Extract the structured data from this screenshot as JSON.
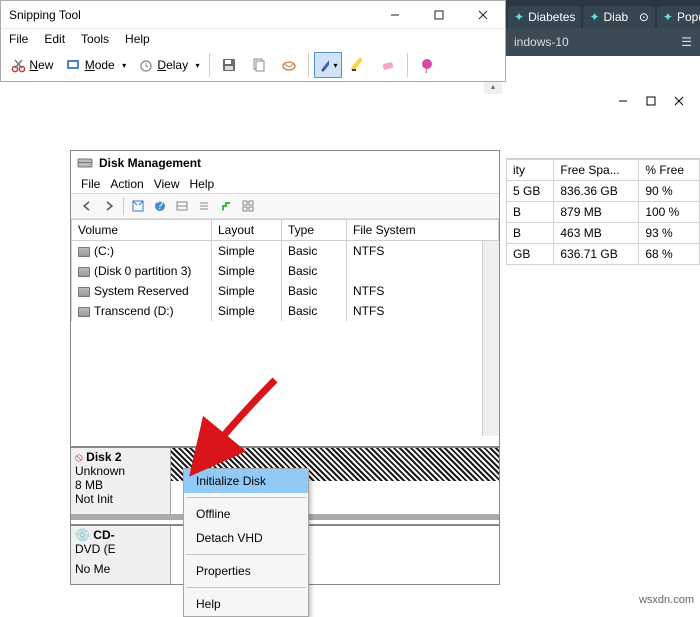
{
  "snipping": {
    "title": "Snipping Tool",
    "menu": {
      "file": "File",
      "edit": "Edit",
      "tools": "Tools",
      "help": "Help"
    },
    "toolbar": {
      "new": "New",
      "mode": "Mode",
      "delay": "Delay"
    }
  },
  "browser": {
    "tabs": [
      "Diabetes",
      "Diab",
      "Popul"
    ],
    "url_fragment": "indows-10"
  },
  "disk_mgmt": {
    "title": "Disk Management",
    "menu": {
      "file": "File",
      "action": "Action",
      "view": "View",
      "help": "Help"
    },
    "columns": {
      "volume": "Volume",
      "layout": "Layout",
      "type": "Type",
      "fs": "File System"
    },
    "volumes": [
      {
        "name": "(C:)",
        "layout": "Simple",
        "type": "Basic",
        "fs": "NTFS"
      },
      {
        "name": "(Disk 0 partition 3)",
        "layout": "Simple",
        "type": "Basic",
        "fs": ""
      },
      {
        "name": "System Reserved",
        "layout": "Simple",
        "type": "Basic",
        "fs": "NTFS"
      },
      {
        "name": "Transcend (D:)",
        "layout": "Simple",
        "type": "Basic",
        "fs": "NTFS"
      }
    ],
    "disk2": {
      "label": "Disk 2",
      "status": "Unknown",
      "size": "8 MB",
      "state": "Not Init"
    },
    "cd": {
      "label": "CD-",
      "line1": "DVD (E",
      "line2": "No Me"
    }
  },
  "context_menu": {
    "initialize": "Initialize Disk",
    "offline": "Offline",
    "detach": "Detach VHD",
    "properties": "Properties",
    "help": "Help"
  },
  "side_table": {
    "headers": {
      "capacity": "ity",
      "free": "Free Spa...",
      "pct": "% Free"
    },
    "rows": [
      {
        "cap": "5 GB",
        "free": "836.36 GB",
        "pct": "90 %"
      },
      {
        "cap": "B",
        "free": "879 MB",
        "pct": "100 %"
      },
      {
        "cap": "B",
        "free": "463 MB",
        "pct": "93 %"
      },
      {
        "cap": "GB",
        "free": "636.71 GB",
        "pct": "68 %"
      }
    ]
  },
  "watermark": "wsxdn.com"
}
